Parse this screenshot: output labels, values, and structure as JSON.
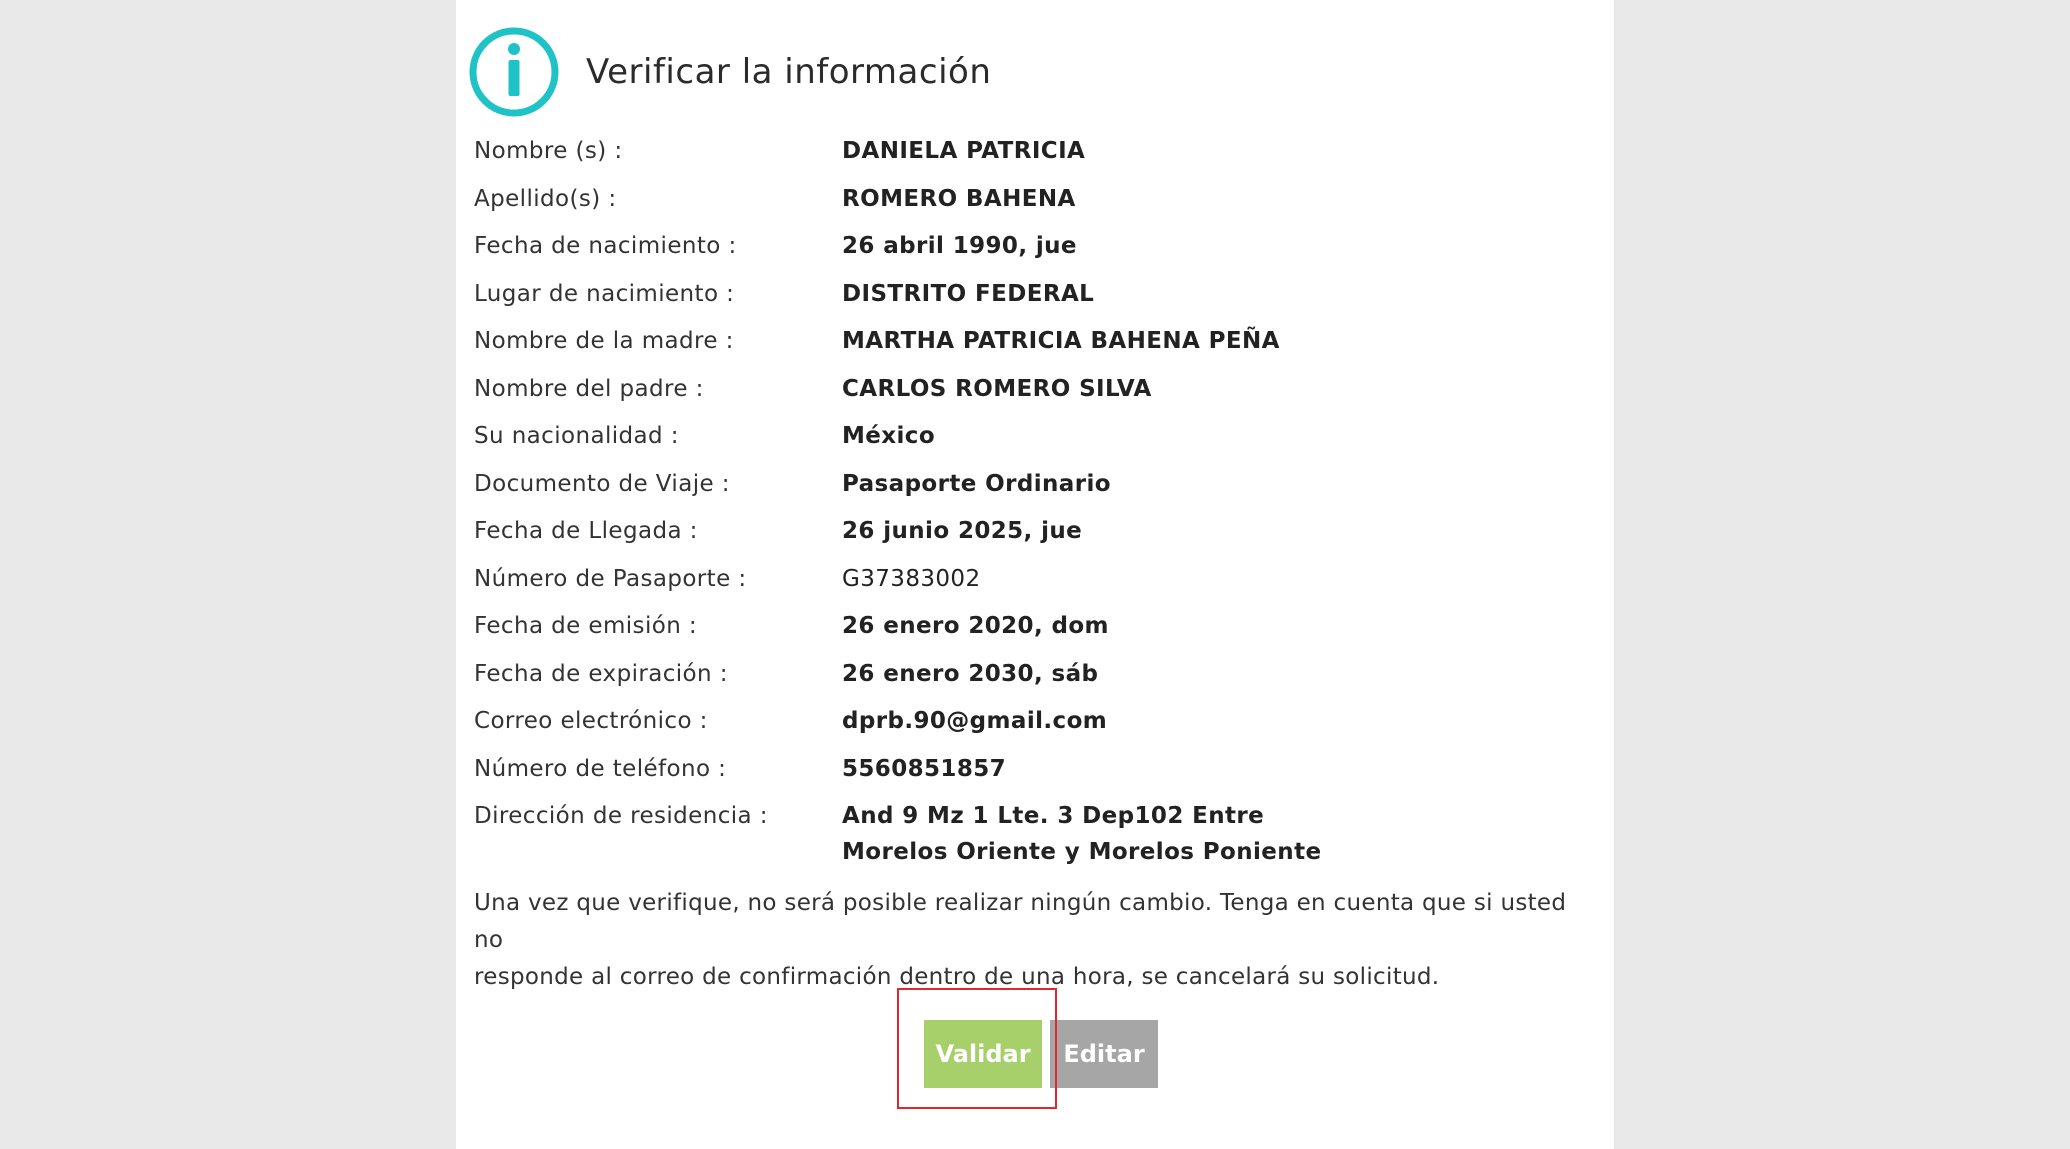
{
  "header": {
    "title": "Verificar la información",
    "icon": "info-icon",
    "icon_color": "#1fc2c6"
  },
  "fields": [
    {
      "label": "Nombre (s) :",
      "value": "DANIELA PATRICIA"
    },
    {
      "label": "Apellido(s) :",
      "value": "ROMERO BAHENA"
    },
    {
      "label": "Fecha de nacimiento :",
      "value": "26 abril 1990, jue"
    },
    {
      "label": "Lugar de nacimiento :",
      "value": "DISTRITO FEDERAL"
    },
    {
      "label": "Nombre de la madre :",
      "value": "MARTHA PATRICIA BAHENA PEÑA"
    },
    {
      "label": "Nombre del padre :",
      "value": "CARLOS ROMERO SILVA"
    },
    {
      "label": "Su nacionalidad :",
      "value": "México"
    },
    {
      "label": "Documento de Viaje :",
      "value": "Pasaporte Ordinario"
    },
    {
      "label": "Fecha de Llegada :",
      "value": "26 junio 2025, jue"
    },
    {
      "label": "Número de Pasaporte :",
      "value": "G37383002"
    },
    {
      "label": "Fecha de emisión :",
      "value": "26 enero 2020, dom"
    },
    {
      "label": "Fecha de expiración :",
      "value": "26 enero 2030, sáb"
    },
    {
      "label": "Correo electrónico :",
      "value": "dprb.90@gmail.com"
    },
    {
      "label": "Número de teléfono :",
      "value": "5560851857"
    },
    {
      "label": "Dirección de residencia :",
      "value_line1": "And 9 Mz 1 Lte. 3 Dep102 Entre",
      "value_line2": "Morelos Oriente y Morelos Poniente"
    }
  ],
  "notice": {
    "line1": "Una vez que verifique, no será posible realizar ningún cambio. Tenga en cuenta que si usted no",
    "line2": "responde al correo de confirmación dentro de una hora, se cancelará su solicitud."
  },
  "buttons": {
    "validate_label": "Validar",
    "edit_label": "Editar",
    "validate_color": "#a8d06a",
    "edit_color": "#a6a6a6"
  },
  "highlight_color": "#e0282e"
}
